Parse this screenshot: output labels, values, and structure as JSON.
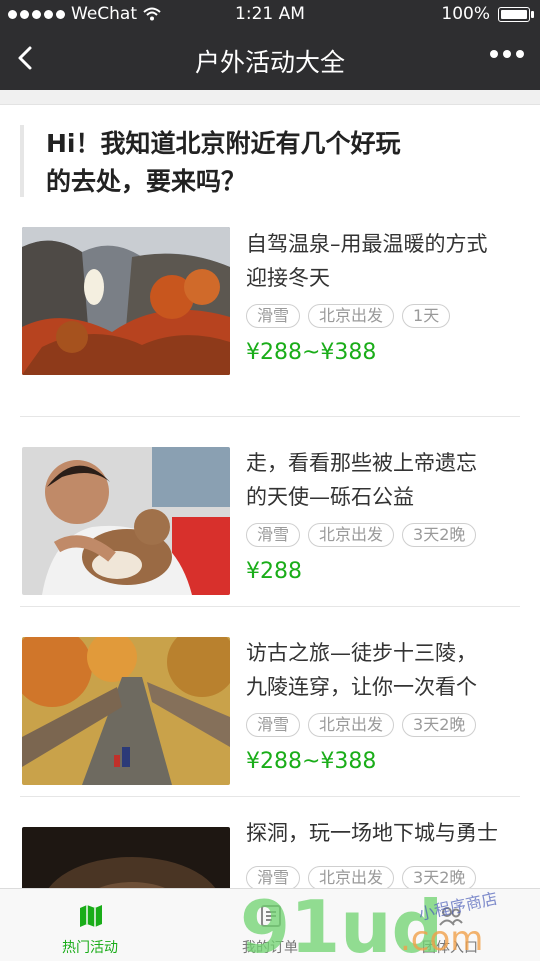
{
  "status": {
    "carrier": "WeChat",
    "time": "1:21 AM",
    "battery": "100%"
  },
  "nav": {
    "title": "户外活动大全"
  },
  "intro": {
    "line1": "Hi！我知道北京附近有几个好玩",
    "line2": "的去处，要来吗？"
  },
  "activities": [
    {
      "title1": "自驾温泉–用最温暖的方式",
      "title2": "迎接冬天",
      "tags": [
        "滑雪",
        "北京出发",
        "1天"
      ],
      "price": "¥288~¥388",
      "image": "autumn-cliff-photo"
    },
    {
      "title1": "走，看看那些被上帝遗忘",
      "title2": "的天使—砾石公益",
      "tags": [
        "滑雪",
        "北京出发",
        "3天2晚"
      ],
      "price": "¥288",
      "image": "child-with-dog-photo"
    },
    {
      "title1": "访古之旅—徒步十三陵，",
      "title2": "九陵连穿，让你一次看个",
      "tags": [
        "滑雪",
        "北京出发",
        "3天2晚"
      ],
      "price": "¥288~¥388",
      "image": "great-wall-photo"
    },
    {
      "title1": "探洞，玩一场地下城与勇士",
      "title2": "",
      "tags": [
        "滑雪",
        "北京出发",
        "3天2晚"
      ],
      "price": "",
      "image": "cave-photo"
    }
  ],
  "tabs": [
    {
      "label": "热门活动",
      "icon": "map-icon",
      "active": true
    },
    {
      "label": "我的订单",
      "icon": "order-icon",
      "active": false
    },
    {
      "label": "团体入口",
      "icon": "group-icon",
      "active": false
    }
  ],
  "watermark": {
    "brand": "91ud",
    "suffix": ".com",
    "sub": "小程序商店"
  },
  "colors": {
    "bar": "#2e2e30",
    "accent": "#1aad19"
  }
}
